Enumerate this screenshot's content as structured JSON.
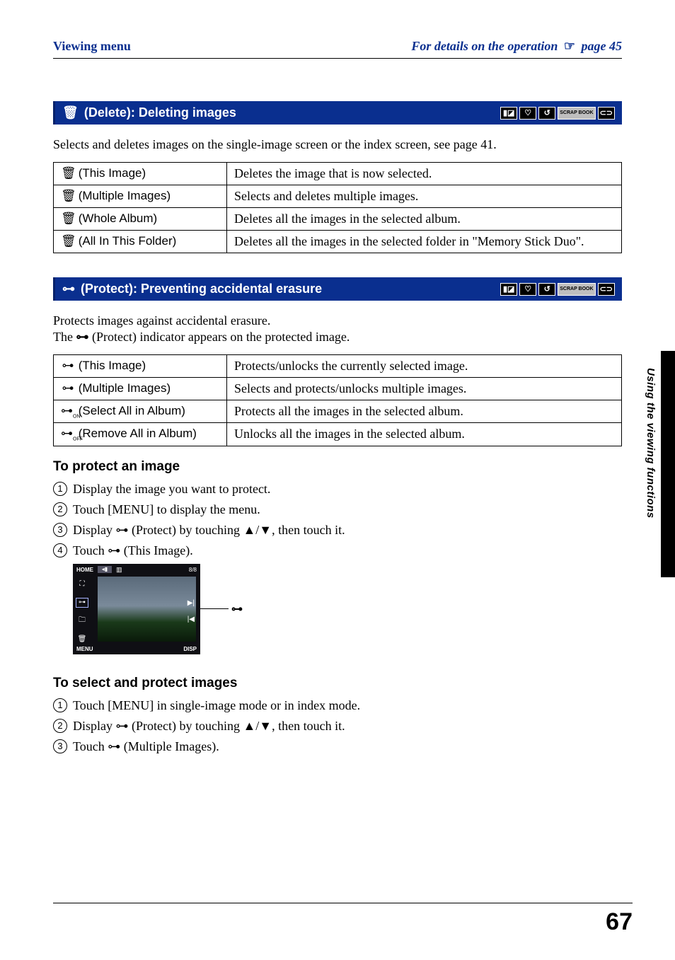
{
  "header": {
    "left": "Viewing menu",
    "right_prefix": "For details on the operation",
    "right_page_ref": "page 45"
  },
  "side_label": "Using the viewing functions",
  "page_number": "67",
  "section_delete": {
    "title": "(Delete): Deleting images",
    "intro": "Selects and deletes images on the single-image screen or the index screen, see page 41.",
    "rows": [
      {
        "label": "(This Image)",
        "desc": "Deletes the image that is now selected."
      },
      {
        "label": "(Multiple Images)",
        "desc": "Selects and deletes multiple images."
      },
      {
        "label": "(Whole Album)",
        "desc": "Deletes all the images in the selected album."
      },
      {
        "label": "(All In This Folder)",
        "desc": "Deletes all the images in the selected folder in \"Memory Stick Duo\"."
      }
    ]
  },
  "section_protect": {
    "title": "(Protect): Preventing accidental erasure",
    "intro_line1": "Protects images against accidental erasure.",
    "intro_line2_before": "The ",
    "intro_line2_after": " (Protect) indicator appears on the protected image.",
    "rows": [
      {
        "label": "(This Image)",
        "desc": "Protects/unlocks the currently selected image."
      },
      {
        "label": "(Multiple Images)",
        "desc": "Selects and protects/unlocks multiple images."
      },
      {
        "label": "(Select All in Album)",
        "desc": "Protects all the images in the selected album."
      },
      {
        "label": "(Remove All in Album)",
        "desc": "Unlocks all the images in the selected album."
      }
    ]
  },
  "protect_image_sub": {
    "heading": "To protect an image",
    "steps": [
      "Display the image you want to protect.",
      "Touch [MENU] to display the menu.",
      "Display ⊶ (Protect) by touching ▲/▼, then touch it.",
      "Touch ⊶ (This Image)."
    ]
  },
  "select_protect_sub": {
    "heading": "To select and protect images",
    "steps": [
      "Touch [MENU] in single-image mode or in index mode.",
      "Display ⊶ (Protect) by touching ▲/▼, then touch it.",
      "Touch ⊶ (Multiple Images)."
    ]
  },
  "screen": {
    "home": "HOME",
    "count": "8/8",
    "menu": "MENU",
    "disp": "DISP"
  },
  "mode_labels": {
    "scrap": "SCRAP\nBOOK"
  }
}
